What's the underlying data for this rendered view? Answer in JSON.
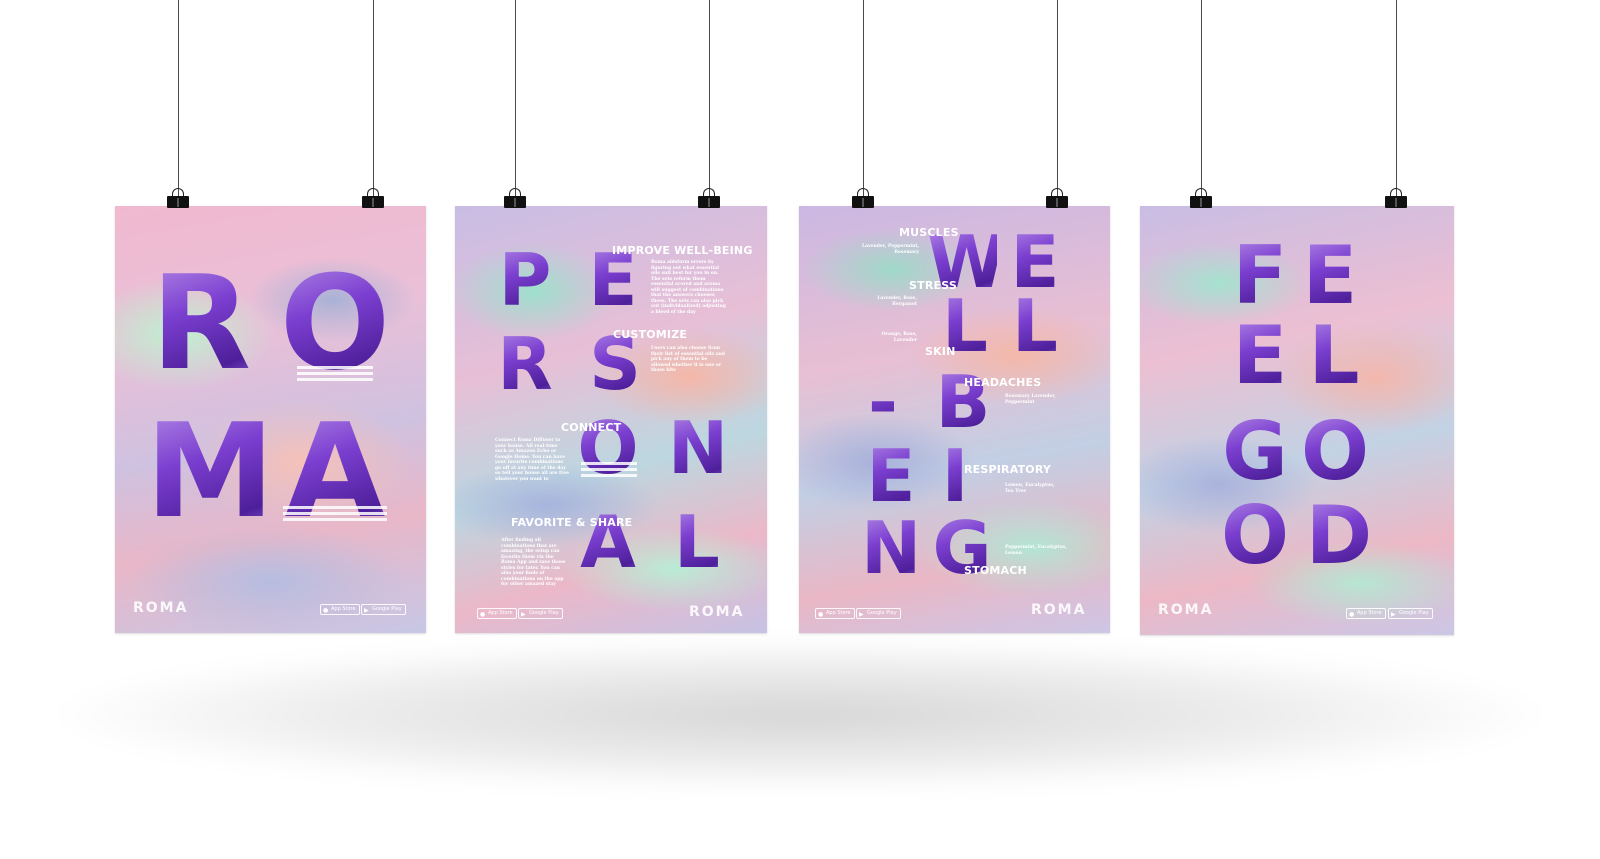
{
  "colors": {
    "string": "#4a4a4a",
    "clip": "#111111",
    "letter_fill_start": "#b38ae6",
    "letter_fill_end": "#4e1f9a",
    "text": "#ffffff"
  },
  "store_badges": {
    "app_store": "App Store",
    "google_play": "Google Play"
  },
  "posters": [
    {
      "letters": [
        "R",
        "O",
        "M",
        "A"
      ],
      "brand": "ROMA"
    },
    {
      "letters": [
        "P",
        "E",
        "R",
        "S",
        "O",
        "N",
        "A",
        "L"
      ],
      "brand": "ROMA",
      "sections": [
        {
          "title": "IMPROVE WELL-BEING",
          "body": "Roma aidsform errors by figuring out what essential oils suit best for you in on. The sets reform them essential scored and aroma will suggest of combinations that the answers chooses these. The sets can also pick out (individualized) adjusting a bleed of the day"
        },
        {
          "title": "CUSTOMIZE",
          "body": "Users can also choose from their list of essential oils and pick any of them to be allowed whether it is one or those kits"
        },
        {
          "title": "CONNECT",
          "body": "Connect Roma Diffuser to your house. All real-time such as Amazon Echo or Google Home. You can have your favorite combinations go off at any time of the day so tell your house all are free whatever you want to"
        },
        {
          "title": "FAVORITE & SHARE",
          "body": "After finding all combinations that are amazing, the setup can favorite them via the Roma App and save those styles for later. You can also your finds of combinations on the app for other amazed stay"
        }
      ]
    },
    {
      "letters": [
        "W",
        "E",
        "L",
        "L",
        "-",
        "B",
        "E",
        "I",
        "N",
        "G"
      ],
      "brand": "ROMA",
      "sections": [
        {
          "title": "MUSCLES",
          "body": "Lavender, Peppermint, Rosemary"
        },
        {
          "title": "STRESS",
          "body": "Lavender, Rose, Bergamot"
        },
        {
          "title": "SKIN",
          "body": "Orange, Rose, Lavender"
        },
        {
          "title": "HEADACHES",
          "body": "Rosemary Lavender, Peppermint"
        },
        {
          "title": "RESPIRATORY",
          "body": "Lemon, Eucalyptus, Tea Tree"
        },
        {
          "title": "STOMACH",
          "body": "Peppermint, Eucalyptus, Lemon"
        }
      ]
    },
    {
      "letters": [
        "F",
        "E",
        "E",
        "L",
        "G",
        "O",
        "O",
        "D"
      ],
      "brand": "ROMA"
    }
  ]
}
